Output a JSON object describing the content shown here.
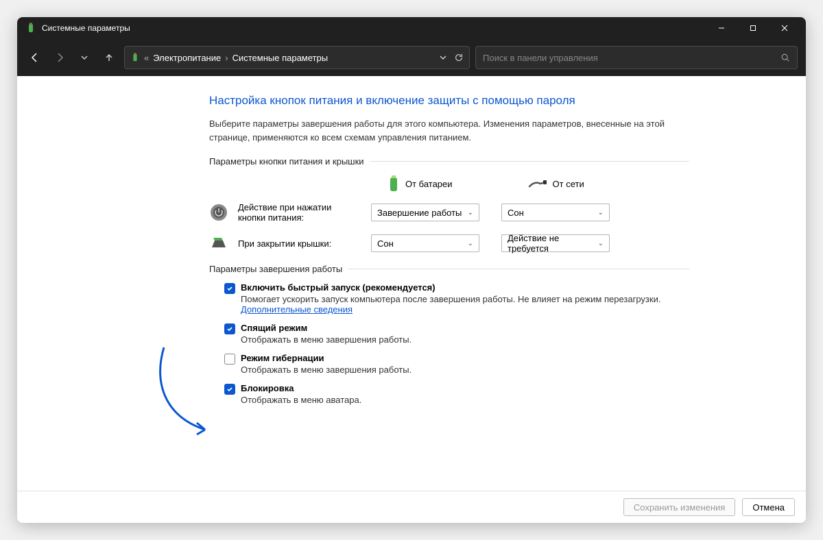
{
  "window": {
    "title": "Системные параметры"
  },
  "breadcrumb": {
    "item1": "Электропитание",
    "item2": "Системные параметры"
  },
  "search": {
    "placeholder": "Поиск в панели управления"
  },
  "page": {
    "heading": "Настройка кнопок питания и включение защиты с помощью пароля",
    "subtext": "Выберите параметры завершения работы для этого компьютера. Изменения параметров, внесенные на этой странице, применяются ко всем схемам управления питанием."
  },
  "section1": {
    "title": "Параметры кнопки питания и крышки",
    "col_battery": "От батареи",
    "col_ac": "От сети",
    "row_power_label": "Действие при нажатии кнопки питания:",
    "row_power_battery": "Завершение работы",
    "row_power_ac": "Сон",
    "row_lid_label": "При закрытии крышки:",
    "row_lid_battery": "Сон",
    "row_lid_ac": "Действие не требуется"
  },
  "section2": {
    "title": "Параметры завершения работы",
    "items": [
      {
        "checked": true,
        "label": "Включить быстрый запуск (рекомендуется)",
        "desc": "Помогает ускорить запуск компьютера после завершения работы. Не влияет на режим перезагрузки.",
        "link": "Дополнительные сведения"
      },
      {
        "checked": true,
        "label": "Спящий режим",
        "desc": "Отображать в меню завершения работы."
      },
      {
        "checked": false,
        "label": "Режим гибернации",
        "desc": "Отображать в меню завершения работы."
      },
      {
        "checked": true,
        "label": "Блокировка",
        "desc": "Отображать в меню аватара."
      }
    ]
  },
  "footer": {
    "save": "Сохранить изменения",
    "cancel": "Отмена"
  }
}
